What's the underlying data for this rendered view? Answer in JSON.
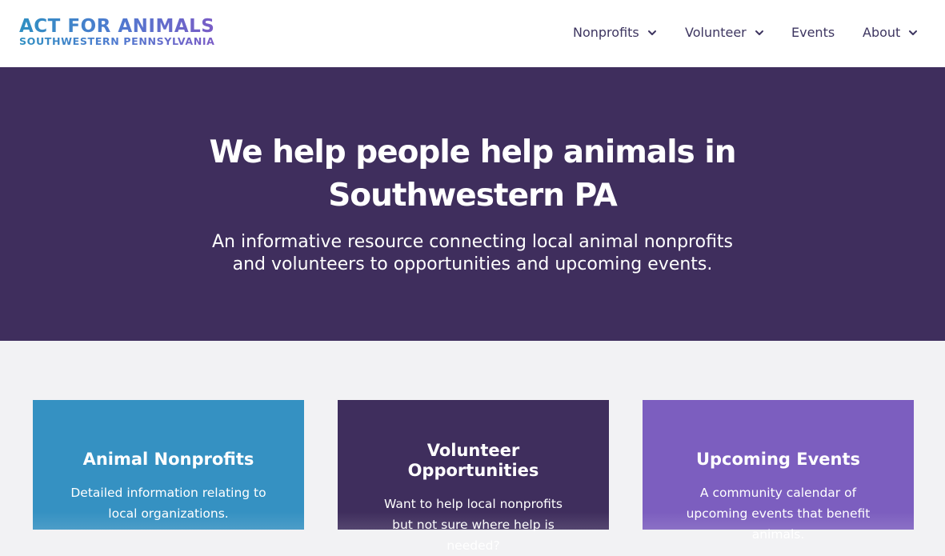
{
  "header": {
    "logo": {
      "line1": "ACT FOR ANIMALS",
      "line2": "SOUTHWESTERN PENNSYLVANIA"
    },
    "nav": [
      {
        "label": "Nonprofits",
        "has_dropdown": true,
        "icon": "chevron-down-icon"
      },
      {
        "label": "Volunteer",
        "has_dropdown": true,
        "icon": "chevron-down-icon"
      },
      {
        "label": "Events",
        "has_dropdown": false
      },
      {
        "label": "About",
        "has_dropdown": true,
        "icon": "chevron-down-icon"
      }
    ]
  },
  "hero": {
    "title_line1": "We help people help animals in",
    "title_line2": "Southwestern PA",
    "subtitle_line1": "An informative resource connecting local animal nonprofits",
    "subtitle_line2": "and volunteers to opportunities and upcoming events."
  },
  "cards": [
    {
      "title": "Animal Nonprofits",
      "description": "Detailed information relating to local organizations.",
      "color": "#3591c2"
    },
    {
      "title": "Volunteer Opportunities",
      "description": "Want to help local nonprofits but not sure where help is needed?",
      "color": "#3f2e5d"
    },
    {
      "title": "Upcoming Events",
      "description": "A community calendar of upcoming events that benefit animals.",
      "color": "#7c5ebf"
    }
  ],
  "colors": {
    "header_bg": "#ffffff",
    "hero_bg": "#3f2e5d",
    "page_bg": "#f2f2f4",
    "nav_text": "#3d3560"
  }
}
